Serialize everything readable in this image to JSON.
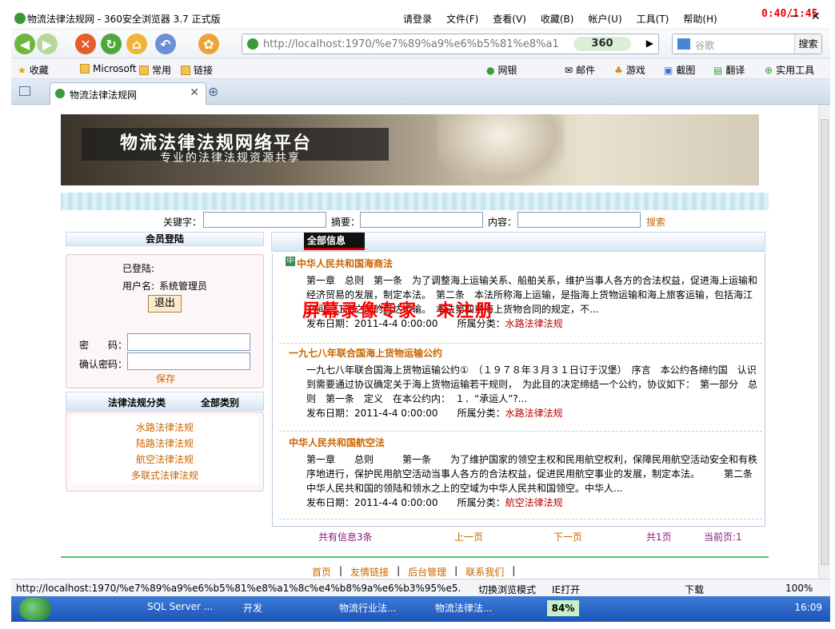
{
  "browser": {
    "title": "物流法律法规网 - 360安全浏览器 3.7 正式版",
    "login_label": "请登录",
    "menus": [
      "文件(F)",
      "查看(V)",
      "收藏(B)",
      "帐户(U)",
      "工具(T)",
      "帮助(H)"
    ],
    "recorder_time": "0:40/1:45",
    "address": "http://localhost:1970/%e7%89%a9%e6%b5%81%e8%a1%",
    "brand_badge": "360",
    "search_placeholder": "谷歌",
    "search_button": "搜索",
    "favorites": [
      "收藏",
      "Microsoft",
      "常用",
      "链接"
    ],
    "toolbar_right": [
      "网银",
      "邮件",
      "游戏",
      "截图",
      "翻译",
      "实用工具"
    ],
    "tab_title": "物流法律法规网",
    "status_url": "http://localhost:1970/%e7%89%a9%e6%b5%81%e8%a1%8c%e4%b8%9a%e6%b3%95%e5...",
    "status_items": [
      "切换浏览模式",
      "IE打开",
      "下载",
      "100%"
    ]
  },
  "site": {
    "banner_title": "物流法律法规网络平台",
    "banner_subtitle": "专业的法律法规资源共享",
    "search": {
      "keyword_label": "关键字：",
      "summary_label": "摘要：",
      "content_label": "内容：",
      "button": "搜索"
    },
    "member": {
      "heading": "会员登陆",
      "logged_in": "已登陆:",
      "username_label": "用户名:",
      "username": "系统管理员",
      "logout": "退出",
      "password_label": "密　　码：",
      "confirm_label": "确认密码：",
      "save": "保存"
    },
    "categories": {
      "heading": "法律法规分类",
      "all": "全部类别",
      "items": [
        "水路法律法规",
        "陆路法律法规",
        "航空法律法规",
        "多联式法律法规"
      ]
    },
    "list": {
      "tab": "全部信息",
      "date_label": "发布日期：",
      "category_label": "所属分类：",
      "items": [
        {
          "title": "中华人民共和国海商法",
          "body": "第一章　总则　第一条　为了调整海上运输关系、船舶关系，维护当事人各方的合法权益，促进海上运输和经济贸易的发展，制定本法。　第二条　本法所称海上运输，是指海上货物运输和海上旅客运输，包括海江之间、江海之间的直达运输。　本法第四章海上货物合同的规定，不...",
          "date": "2011-4-4 0:00:00",
          "category": "水路法律法规"
        },
        {
          "title": "一九七八年联合国海上货物运输公约",
          "body": "一九七八年联合国海上货物运输公约①　（１９７８年３月３１日订于汉堡）　序言　本公约各缔约国　认识到需要通过协议确定关于海上货物运输若干规则，　为此目的决定缔结一个公约，协议如下：　第一部分　总则　第一条　定义　在本公约内：　１．“承运人”?...",
          "date": "2011-4-4 0:00:00",
          "category": "水路法律法规"
        },
        {
          "title": "中华人民共和国航空法",
          "body": "第一章　　总则　　　第一条　　为了维护国家的领空主权和民用航空权利，保障民用航空活动安全和有秩序地进行，保护民用航空活动当事人各方的合法权益，促进民用航空事业的发展，制定本法。　　　第二条　　中华人民共和国的领陆和领水之上的空域为中华人民共和国领空。中华人...",
          "date": "2011-4-4 0:00:00",
          "category": "航空法律法规"
        }
      ]
    },
    "pager": {
      "total": "共有信息3条",
      "prev": "上一页",
      "next": "下一页",
      "pages": "共1页",
      "current": "当前页:1"
    },
    "footer": [
      "首页",
      "友情链接",
      "后台管理",
      "联系我们"
    ],
    "watermark": "屏幕录像专家　未注册"
  },
  "taskbar": {
    "items": [
      "SQL Server ...",
      "开发",
      "物流行业法...",
      "物流法律法..."
    ],
    "battery": "84%",
    "clock": "16:09"
  }
}
